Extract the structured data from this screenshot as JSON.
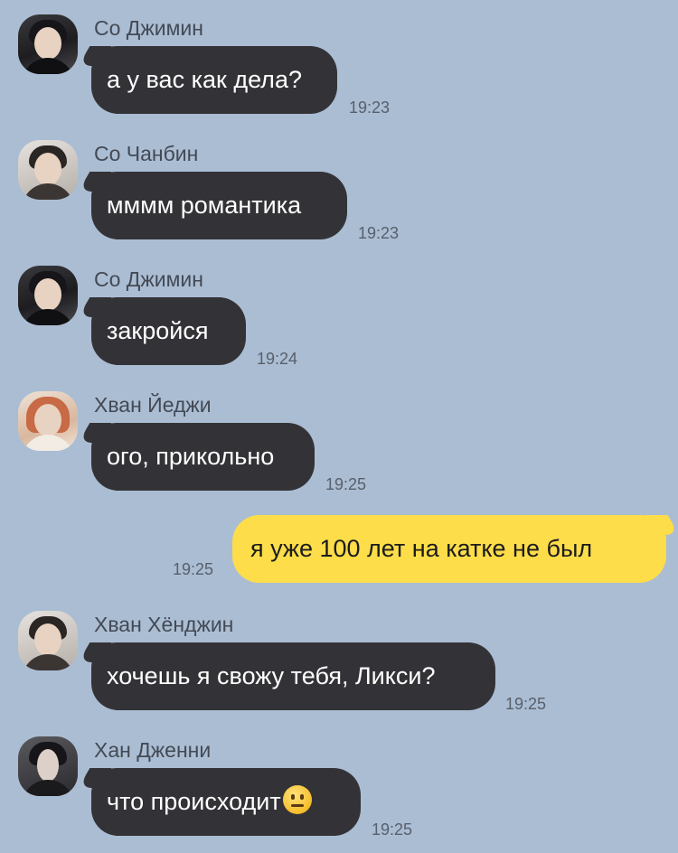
{
  "chat": {
    "messages": [
      {
        "sender": "Со Джимин",
        "text": "а у вас как дела?",
        "time": "19:23",
        "avatar": "avatar-sojimin"
      },
      {
        "sender": "Со Чанбин",
        "text": "мммм романтика",
        "time": "19:23",
        "avatar": "avatar-sochanbin"
      },
      {
        "sender": "Со Джимин",
        "text": "закройся",
        "time": "19:24",
        "avatar": "avatar-sojimin"
      },
      {
        "sender": "Хван Йеджи",
        "text": "ого, прикольно",
        "time": "19:25",
        "avatar": "avatar-hwanyeji"
      },
      {
        "outgoing": true,
        "text": "я уже 100 лет на катке не был",
        "time": "19:25"
      },
      {
        "sender": "Хван Хёнджин",
        "text": "хочешь я свожу тебя, Ликси?",
        "time": "19:25",
        "avatar": "avatar-hwanhyunjin"
      },
      {
        "sender": "Хан Дженни",
        "text": "что происходит",
        "time": "19:25",
        "emoji": "neutral-face-emoji",
        "avatar": "avatar-hanjenni"
      }
    ]
  },
  "colors": {
    "background": "#abbdd3",
    "incoming_bubble": "#333337",
    "outgoing_bubble": "#fddd49",
    "sender_name": "#434a55",
    "timestamp": "#58606c"
  }
}
